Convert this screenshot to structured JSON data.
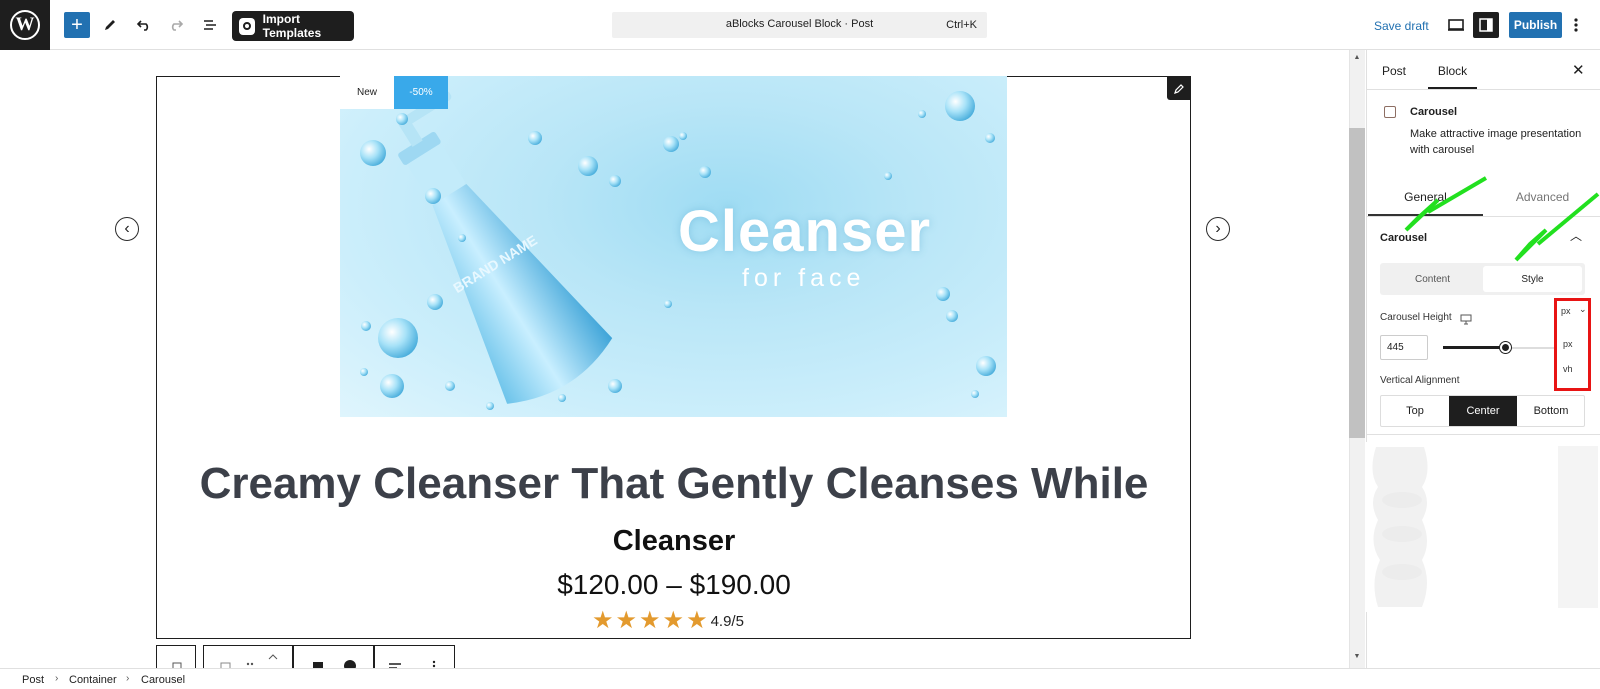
{
  "toolbar": {
    "import_label": "Import Templates",
    "document_title": "aBlocks Carousel Block · Post",
    "shortcut": "Ctrl+K",
    "save_draft_label": "Save draft",
    "publish_label": "Publish"
  },
  "slide": {
    "badge_new": "New",
    "badge_sale": "-50%",
    "image_title": "Cleanser",
    "image_subtitle": "for face",
    "bottle_text": "BRAND NAME",
    "product_title": "Creamy Cleanser That Gently Cleanses While",
    "product_subtitle": "Cleanser",
    "price": "$120.00 – $190.00",
    "rating_value": 4.9,
    "rating_text": "4.9/5",
    "stars": 5
  },
  "sidebar": {
    "tabs": [
      {
        "label": "Post"
      },
      {
        "label": "Block"
      }
    ],
    "block_name": "Carousel",
    "block_description": "Make attractive image presentation with carousel",
    "panel_tabs": [
      {
        "label": "General"
      },
      {
        "label": "Advanced"
      }
    ],
    "section_title": "Carousel",
    "segments": [
      {
        "label": "Content"
      },
      {
        "label": "Style"
      }
    ],
    "height_label": "Carousel Height",
    "height_value": "445",
    "height_slider_fraction": 0.55,
    "unit_selected": "px",
    "unit_options": [
      "px",
      "vh"
    ],
    "alignment_label": "Vertical Alignment",
    "alignment_options": [
      "Top",
      "Center",
      "Bottom"
    ],
    "alignment_selected": "Center"
  },
  "breadcrumb": [
    {
      "label": "Post"
    },
    {
      "label": "Container"
    },
    {
      "label": "Carousel"
    }
  ],
  "colors": {
    "accent": "#2271b1",
    "sale_badge": "#39a9ea",
    "star": "#e39a2e",
    "highlight_box": "#e81414",
    "annotation_arrow": "#22e01f"
  }
}
